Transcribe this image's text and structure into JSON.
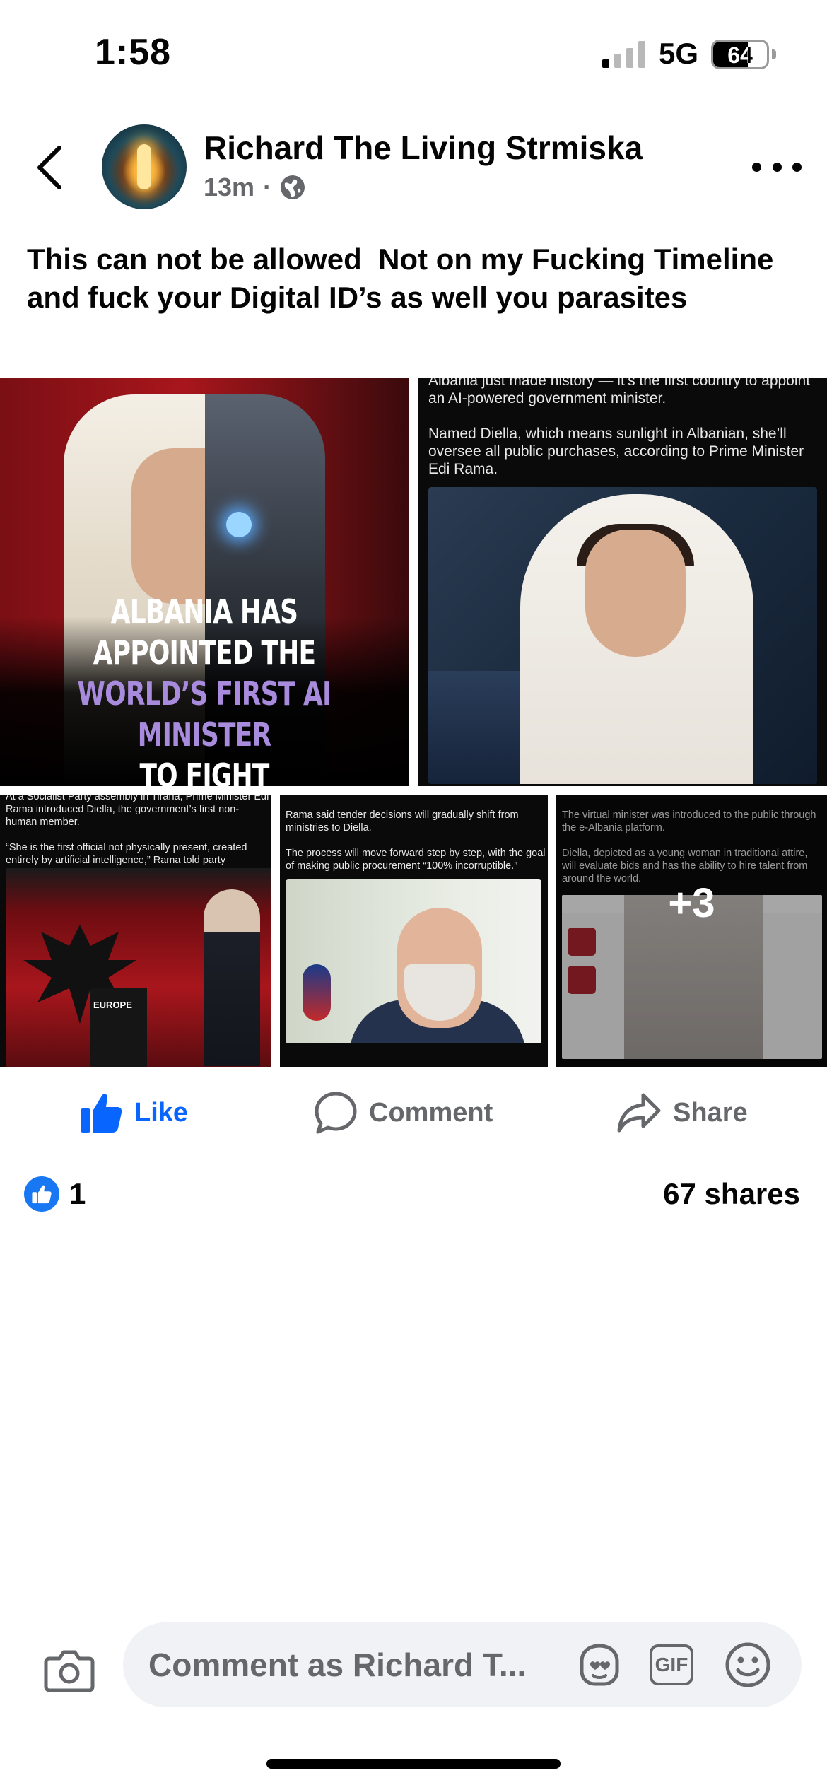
{
  "status_bar": {
    "time": "1:58",
    "network": "5G",
    "battery": "64",
    "signal_bars_active": 1,
    "signal_bars_total": 4
  },
  "post": {
    "author": "Richard The Living Strmiska",
    "time_ago": "13m",
    "separator": "·",
    "audience_icon": "globe-icon",
    "text": "This can not be allowed  Not on my Fucking Timeline and fuck your Digital ID’s as well you parasites"
  },
  "media": {
    "image1": {
      "line1": "ALBANIA HAS APPOINTED THE",
      "line2": "WORLD’S FIRST AI MINISTER",
      "line3": "TO FIGHT CORRUPTION"
    },
    "image2": {
      "caption": "Albania just made history — it’s the first country to appoint an AI-powered government minister.\n\nNamed Diella, which means sunlight in Albanian, she’ll oversee all public purchases, according to Prime Minister Edi Rama."
    },
    "image3": {
      "caption": "At a Socialist Party assembly in Tirana, Prime Minister Edi Rama introduced Diella, the government’s first non-human member.\n\n“She is the first official not physically present, created entirely by artificial intelligence,” Rama told party members.",
      "podium_label": "EUROPE"
    },
    "image4": {
      "caption": "Rama said tender decisions will gradually shift from ministries to Diella.\n\nThe process will move forward step by step, with the goal of making public procurement “100% incorruptible.”"
    },
    "image5": {
      "caption": "The virtual minister was introduced to the public through the e-Albania platform.\n\nDiella, depicted as a young woman in traditional attire, will evaluate bids and has the ability to hire talent from around the world.",
      "more_count": "+3"
    }
  },
  "actions": {
    "like": "Like",
    "comment": "Comment",
    "share": "Share"
  },
  "stats": {
    "reaction_count": "1",
    "shares": "67 shares"
  },
  "composer": {
    "placeholder": "Comment as Richard T...",
    "gif": "GIF"
  },
  "colors": {
    "accent": "#0866ff",
    "secondary": "#65676b",
    "like_badge": "#1877f2"
  }
}
